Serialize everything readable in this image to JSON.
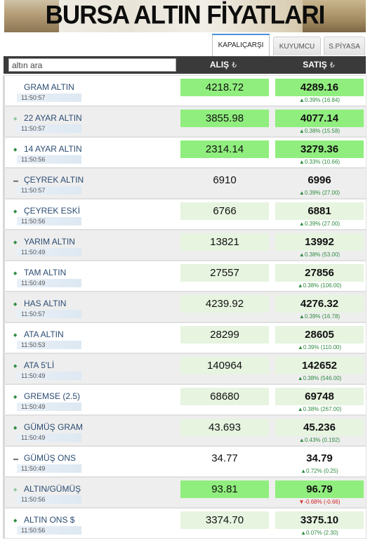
{
  "banner": {
    "title": "BURSA ALTIN FİYATLARI"
  },
  "tabs": [
    {
      "label": "KAPALIÇARŞI",
      "active": true
    },
    {
      "label": "KUYUMCU",
      "active": false
    },
    {
      "label": "S.PİYASA",
      "active": false
    }
  ],
  "search": {
    "placeholder": "altın ara"
  },
  "columns": {
    "alis": "ALIŞ",
    "satis": "SATIŞ",
    "currency_symbol": "₺"
  },
  "colors": {
    "highlight": "#90ee7e",
    "light": "#e6f4e0",
    "up": "#2e8b3e",
    "down": "#cc2222",
    "header_bg": "#3a3a3a"
  },
  "rows": [
    {
      "name": "GRAM ALTIN",
      "time": "11:50:57",
      "alis": "4218.72",
      "satis": "4289.16",
      "change": "▲0.39% (16.84)",
      "trend": "none",
      "style": "hl"
    },
    {
      "name": "22 AYAR ALTIN",
      "time": "11:50:57",
      "alis": "3855.98",
      "satis": "4077.14",
      "change": "▲0.38% (15.58)",
      "trend": "up-light",
      "style": "hl"
    },
    {
      "name": "14 AYAR ALTIN",
      "time": "11:50:56",
      "alis": "2314.14",
      "satis": "3279.36",
      "change": "▲0.33% (10.66)",
      "trend": "up",
      "style": "hl"
    },
    {
      "name": "ÇEYREK ALTIN",
      "time": "11:50:57",
      "alis": "6910",
      "satis": "6996",
      "change": "▲0.39% (27.00)",
      "trend": "flat",
      "style": "none"
    },
    {
      "name": "ÇEYREK ESKİ",
      "time": "11:50:56",
      "alis": "6766",
      "satis": "6881",
      "change": "▲0.39% (27.00)",
      "trend": "up",
      "style": "lt"
    },
    {
      "name": "YARIM ALTIN",
      "time": "11:50:49",
      "alis": "13821",
      "satis": "13992",
      "change": "▲0.38% (53.00)",
      "trend": "up",
      "style": "lt"
    },
    {
      "name": "TAM ALTIN",
      "time": "11:50:49",
      "alis": "27557",
      "satis": "27856",
      "change": "▲0.38% (106.00)",
      "trend": "up",
      "style": "lt"
    },
    {
      "name": "HAS ALTIN",
      "time": "11:50:57",
      "alis": "4239.92",
      "satis": "4276.32",
      "change": "▲0.39% (16.78)",
      "trend": "up",
      "style": "lt"
    },
    {
      "name": "ATA ALTIN",
      "time": "11:50:53",
      "alis": "28299",
      "satis": "28605",
      "change": "▲0.39% (110.00)",
      "trend": "up",
      "style": "lt"
    },
    {
      "name": "ATA 5'Lİ",
      "time": "11:50:49",
      "alis": "140964",
      "satis": "142652",
      "change": "▲0.38% (546.00)",
      "trend": "up",
      "style": "lt"
    },
    {
      "name": "GREMSE (2.5)",
      "time": "11:50:49",
      "alis": "68680",
      "satis": "69748",
      "change": "▲0.38% (267.00)",
      "trend": "up",
      "style": "lt"
    },
    {
      "name": "GÜMÜŞ GRAM",
      "time": "11:50:49",
      "alis": "43.693",
      "satis": "45.236",
      "change": "▲0.43% (0.192)",
      "trend": "up",
      "style": "lt"
    },
    {
      "name": "GÜMÜŞ ONS",
      "time": "11:50:49",
      "alis": "34.77",
      "satis": "34.79",
      "change": "▲0.72% (0.25)",
      "trend": "flat",
      "style": "none"
    },
    {
      "name": "ALTIN/GÜMÜŞ",
      "time": "11:50:56",
      "alis": "93.81",
      "satis": "96.79",
      "change": "▼-0.68% (-0.66)",
      "trend": "up-light",
      "style": "hl"
    },
    {
      "name": "ALTIN ONS $",
      "time": "11:50:56",
      "alis": "3374.70",
      "satis": "3375.10",
      "change": "▲0.07% (2.30)",
      "trend": "up",
      "style": "lt"
    }
  ]
}
